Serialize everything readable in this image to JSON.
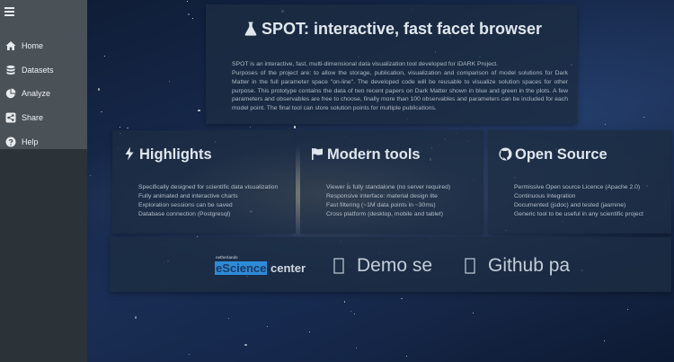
{
  "sidebar": {
    "toggle_icon": "hamburger-icon",
    "items": [
      {
        "label": "Home",
        "icon": "home-icon"
      },
      {
        "label": "Datasets",
        "icon": "database-icon"
      },
      {
        "label": "Analyze",
        "icon": "pie-chart-icon"
      },
      {
        "label": "Share",
        "icon": "share-icon"
      },
      {
        "label": "Help",
        "icon": "question-circle-icon"
      }
    ]
  },
  "hero": {
    "title": "SPOT: interactive, fast facet browser",
    "icon": "flask-icon",
    "body": [
      "SPOT is an interactive, fast, multi-dimensional data visualization tool developed for iDARK Project.",
      "Purposes of the project are: to allow the storage, publication, visualization and comparison of model solutions for Dark Matter in the full parameter space \"on-line\". The developed code will be reusable to visualize solution spaces for other purpose. This prototype contains the data of two recent papers on Dark Matter shown in blue and green in the plots. A few parameters and observables are free to choose, finally more than 100 observables and parameters can be included for each model point. The final tool can store solution points for multiple publications."
    ]
  },
  "cards": [
    {
      "title": "Highlights",
      "icon": "bolt-icon",
      "items": [
        "Specifically designed for scientific data visualization",
        "Fully animated and interactive charts",
        "Exploration sessions can be saved",
        "Database connection (Postgresql)"
      ]
    },
    {
      "title": "Modern tools",
      "icon": "flag-icon",
      "items": [
        "Viewer is fully standalone (no server required)",
        "Responsive interface: material design lite",
        "Fast filtering (~1M data points in ~30ms)",
        "Cross platform (desktop, mobile and tablet)"
      ]
    },
    {
      "title": "Open Source",
      "icon": "github-icon",
      "items": [
        "Permissive Open source Licence (Apache 2.0)",
        "Continuous Integration",
        "Documented (jsdoc) and tested (jasmine)",
        "Generic tool to be useful in any scientific project"
      ]
    }
  ],
  "links": {
    "escience_small": "netherlands",
    "escience_highlight": "eScience",
    "escience_rest": "center",
    "demo_label": "Demo se",
    "demo_icon": "broken-image-icon",
    "github_label": "Github pa",
    "github_icon": "broken-image-icon"
  },
  "colors": {
    "sidebar_bg": "#2b3238",
    "sidebar_menu_bg": "#4a5157",
    "panel_bg": "#1c2c42",
    "escience_highlight": "#2e8bd8"
  }
}
